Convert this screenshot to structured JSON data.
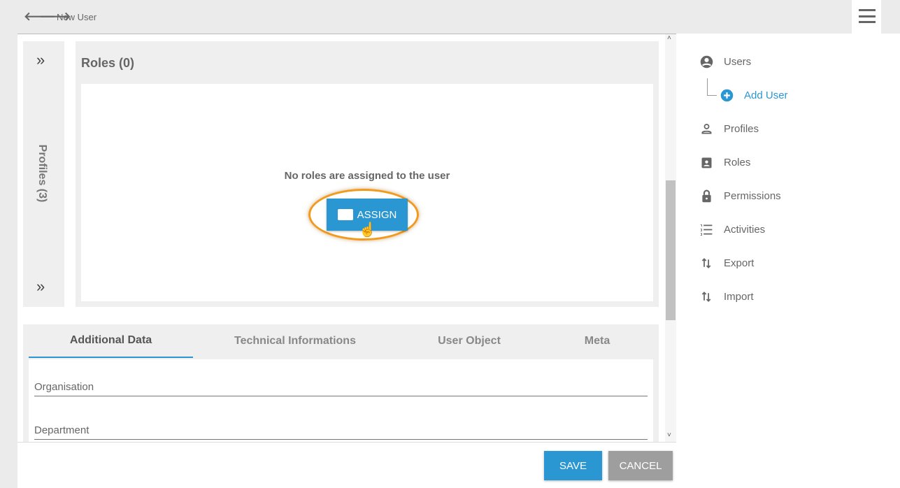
{
  "header": {
    "title": "New User"
  },
  "profiles_panel": {
    "label": "Profiles (3)"
  },
  "roles_panel": {
    "title": "Roles (0)",
    "empty_message": "No roles are assigned to the user",
    "assign_label": "ASSIGN"
  },
  "tabs": [
    {
      "label": "Additional Data",
      "active": true
    },
    {
      "label": "Technical Informations"
    },
    {
      "label": "User Object"
    },
    {
      "label": "Meta"
    }
  ],
  "fields": [
    {
      "label": "Organisation",
      "value": ""
    },
    {
      "label": "Department",
      "value": ""
    }
  ],
  "footer": {
    "save_label": "SAVE",
    "cancel_label": "CANCEL"
  },
  "sidebar": {
    "items": [
      {
        "label": "Users",
        "icon": "account-circle-icon"
      },
      {
        "label": "Add User",
        "icon": "add-circle-icon"
      },
      {
        "label": "Profiles",
        "icon": "person-icon"
      },
      {
        "label": "Roles",
        "icon": "badge-icon"
      },
      {
        "label": "Permissions",
        "icon": "lock-icon"
      },
      {
        "label": "Activities",
        "icon": "list-numbered-icon"
      },
      {
        "label": "Export",
        "icon": "swap-vert-icon"
      },
      {
        "label": "Import",
        "icon": "swap-vert-icon"
      }
    ]
  },
  "colors": {
    "accent": "#2b97d2",
    "highlight": "#f29a1e",
    "cancel": "#9e9e9e"
  }
}
